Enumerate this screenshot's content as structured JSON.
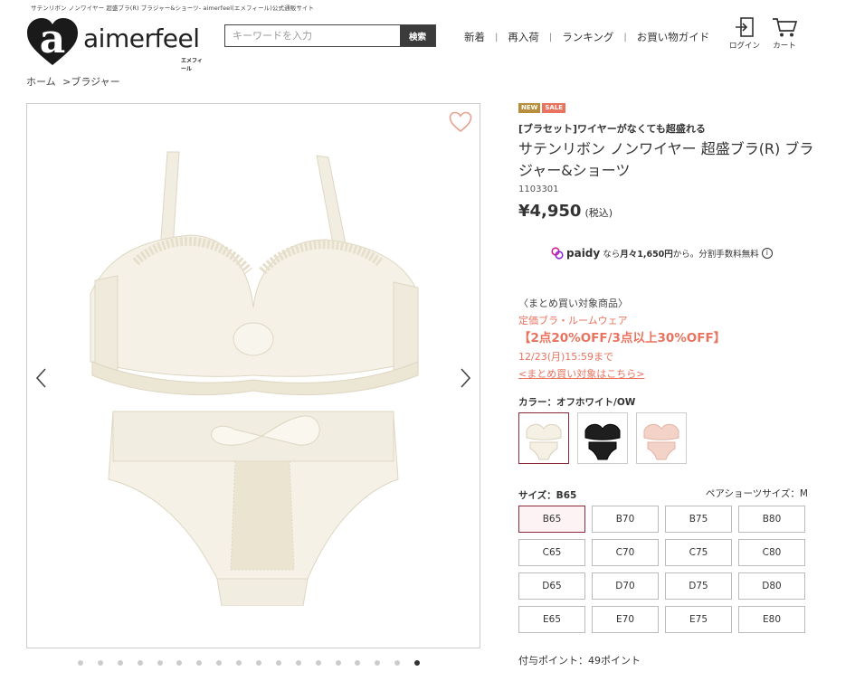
{
  "topline": "サテンリボン ノンワイヤー 超盛ブラ(R) ブラジャー&ショーツ- aimerfeel(エメフィール)公式通販サイト",
  "logo": {
    "word": "aimerfeel",
    "kana": "エメフィール"
  },
  "search": {
    "placeholder": "キーワードを入力",
    "button": "検索"
  },
  "nav": [
    "新着",
    "再入荷",
    "ランキング",
    "お買い物ガイド"
  ],
  "icons": {
    "login": "ログイン",
    "cart": "カート"
  },
  "breadcrumb": [
    "ホーム",
    ">ブラジャー"
  ],
  "gallery": {
    "dot_count": 18,
    "active_dot": 18
  },
  "product": {
    "badges": [
      {
        "text": "NEW",
        "color": "#b78f3c"
      },
      {
        "text": "SALE",
        "color": "#e8735f"
      }
    ],
    "catch": "[ブラセット]ワイヤーがなくても超盛れる",
    "name": "サテンリボン ノンワイヤー 超盛ブラ(R) ブラジャー&ショーツ",
    "code": "1103301",
    "price": "¥4,950",
    "tax": "(税込)"
  },
  "paidy": {
    "brand": "paidy",
    "pre": "なら",
    "monthly": "月々1,650円",
    "post": "から。分割手数料無料"
  },
  "campaign": {
    "label": "〈まとめ買い対象商品〉",
    "target": "定価ブラ・ルームウェア",
    "offer": "【2点20%OFF/3点以上30%OFF】",
    "deadline": "12/23(月)15:59まで",
    "link": "<まとめ買い対象はこちら>"
  },
  "color": {
    "label": "カラー：オフホワイト/OW",
    "swatches": [
      "offwhite",
      "black",
      "pink"
    ],
    "selected": 0
  },
  "size": {
    "label": "サイズ：B65",
    "pair_label": "ペアショーツサイズ：M",
    "options": [
      "B65",
      "B70",
      "B75",
      "B80",
      "C65",
      "C70",
      "C75",
      "C80",
      "D65",
      "D70",
      "D75",
      "D80",
      "E65",
      "E70",
      "E75",
      "E80"
    ],
    "selected": "B65"
  },
  "points": "付与ポイント：49ポイント",
  "colors": {
    "accent": "#e8735f",
    "selected_border": "#8b2a3a",
    "heart": "#e8a08f"
  }
}
